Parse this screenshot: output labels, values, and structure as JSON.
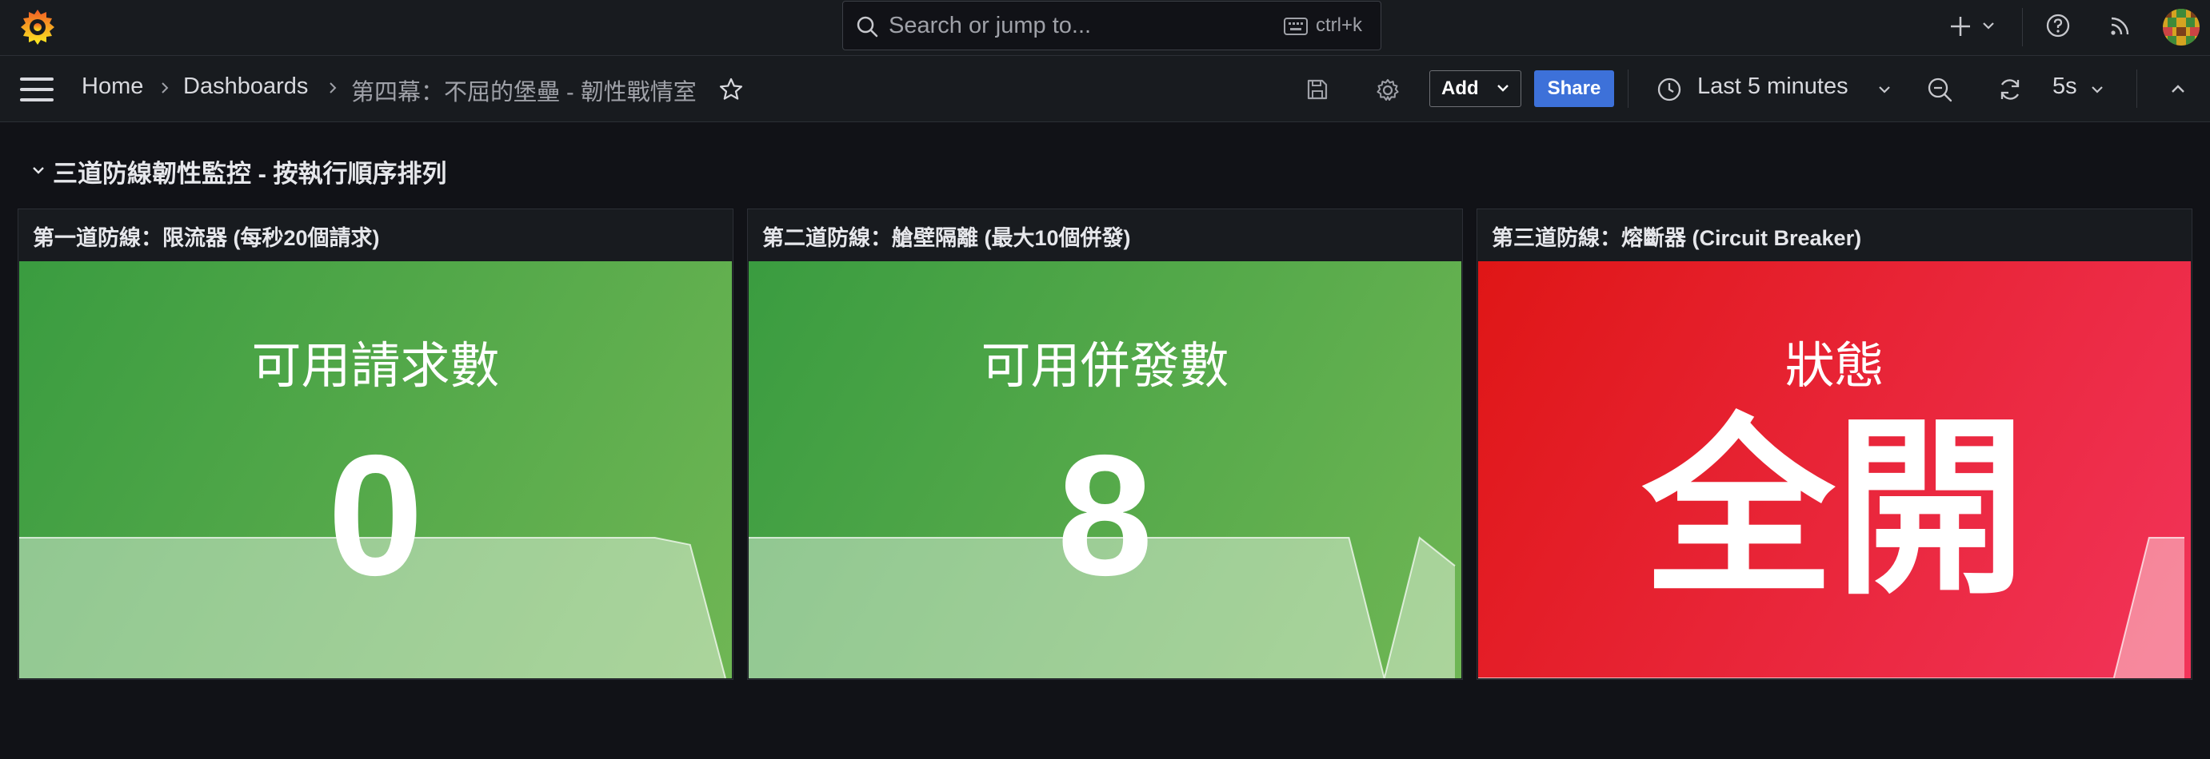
{
  "topbar": {
    "search": {
      "placeholder": "Search or jump to...",
      "shortcut": "ctrl+k"
    },
    "icons": [
      "grafana-logo-icon",
      "search-icon",
      "keyboard-icon",
      "plus-icon",
      "chevron-down-icon",
      "help-icon",
      "rss-icon",
      "avatar"
    ]
  },
  "navbar": {
    "breadcrumbs": [
      {
        "label": "Home"
      },
      {
        "label": "Dashboards"
      },
      {
        "label": "第四幕：不屈的堡壘 - 韌性戰情室"
      }
    ],
    "add_label": "Add",
    "share_label": "Share",
    "time_range": "Last 5 minutes",
    "refresh_interval": "5s"
  },
  "row": {
    "title": "三道防線韌性監控 - 按執行順序排列"
  },
  "panels": [
    {
      "title": "第一道防線：限流器 (每秒20個請求)",
      "label": "可用請求數",
      "value": "0",
      "color": "#56a64b",
      "sparkline": [
        20,
        20,
        20,
        20,
        20,
        20,
        20,
        20,
        20,
        20,
        20,
        20,
        20,
        20,
        20,
        20,
        20,
        20,
        20,
        19,
        0
      ]
    },
    {
      "title": "第二道防線：艙壁隔離 (最大10個併發)",
      "label": "可用併發數",
      "value": "8",
      "color": "#56a64b",
      "sparkline": [
        10,
        10,
        10,
        10,
        10,
        10,
        10,
        10,
        10,
        10,
        10,
        10,
        10,
        10,
        10,
        10,
        10,
        10,
        0,
        10,
        8
      ]
    },
    {
      "title": "第三道防線：熔斷器 (Circuit Breaker)",
      "label": "狀態",
      "value": "全開",
      "color": "#f2495c",
      "sparkline": [
        0,
        0,
        0,
        0,
        0,
        0,
        0,
        0,
        0,
        0,
        0,
        0,
        0,
        0,
        0,
        0,
        0,
        0,
        0,
        1,
        1
      ]
    }
  ]
}
